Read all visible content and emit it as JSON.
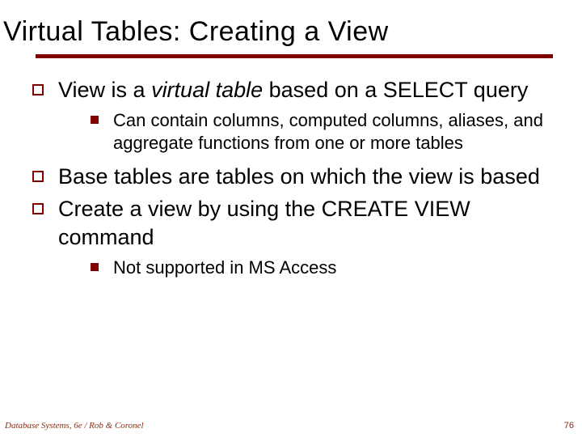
{
  "slide": {
    "title": "Virtual Tables: Creating a View",
    "bullets": [
      {
        "text_pre": "View is a ",
        "text_em": "virtual table",
        "text_post": " based on a SELECT query",
        "sub": [
          {
            "text": "Can contain columns, computed columns, aliases, and aggregate functions from one or more tables"
          }
        ]
      },
      {
        "text": "Base tables are tables on which the view is based",
        "sub": []
      },
      {
        "text": "Create a view by using the CREATE VIEW command",
        "sub": [
          {
            "text": "Not supported in MS Access"
          }
        ]
      }
    ],
    "footer_left": "Database Systems, 6e / Rob & Coronel",
    "footer_right": "76"
  }
}
